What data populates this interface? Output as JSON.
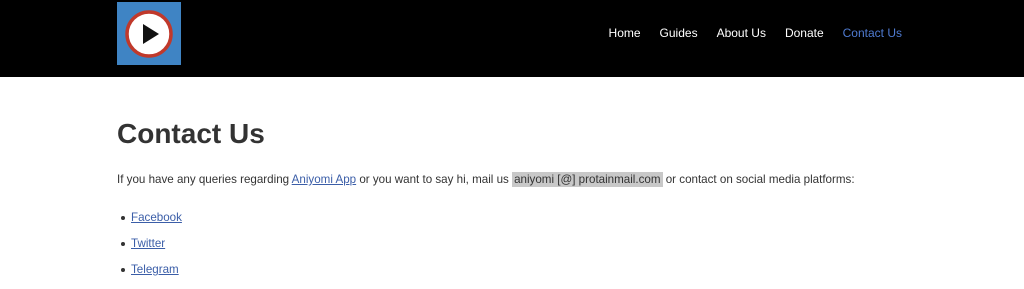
{
  "header": {
    "logo_alt": "Aniyomi logo",
    "nav": [
      {
        "label": "Home",
        "active": false
      },
      {
        "label": "Guides",
        "active": false
      },
      {
        "label": "About Us",
        "active": false
      },
      {
        "label": "Donate",
        "active": false
      },
      {
        "label": "Contact Us",
        "active": true
      }
    ]
  },
  "main": {
    "title": "Contact Us",
    "intro": {
      "part1": "If you have any queries regarding ",
      "app_link": "Aniyomi App",
      "part2": " or you want to say hi, mail us ",
      "email": "aniyomi [@] protainmail.com",
      "part3": " or contact on social media platforms:"
    },
    "social_links": [
      {
        "label": "Facebook"
      },
      {
        "label": "Twitter"
      },
      {
        "label": "Telegram"
      }
    ]
  },
  "colors": {
    "header_bg": "#000000",
    "logo_bg": "#3f84c4",
    "nav_active": "#4f7bd1",
    "link": "#3b5ea8",
    "email_highlight": "#c8c8c8"
  }
}
